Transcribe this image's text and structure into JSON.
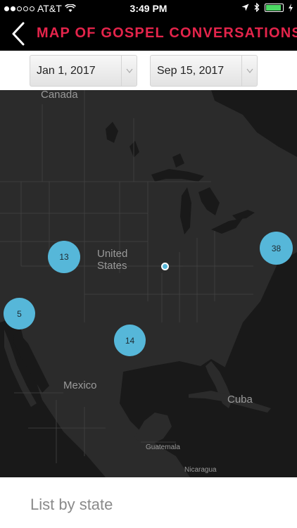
{
  "status_bar": {
    "carrier": "AT&T",
    "time": "3:49 PM",
    "signal_bars": 2,
    "battery_level": 0.9,
    "icons": [
      "signal-icon",
      "wifi-icon",
      "location-arrow-icon",
      "bluetooth-icon",
      "battery-icon",
      "charging-icon"
    ]
  },
  "header": {
    "title": "MAP OF GOSPEL CONVERSATIONS",
    "back_icon": "back-chevron-icon",
    "title_color": "#e4244b"
  },
  "filters": {
    "start_date": "Jan 1, 2017",
    "end_date": "Sep 15, 2017"
  },
  "map": {
    "labels": {
      "canada": "Canada",
      "united_states": "United\nStates",
      "mexico": "Mexico",
      "cuba": "Cuba",
      "guatemala": "Guatemala",
      "nicaragua": "Nicaragua"
    },
    "clusters": [
      {
        "id": "west",
        "count": "13"
      },
      {
        "id": "southwest",
        "count": "5"
      },
      {
        "id": "texas",
        "count": "14"
      },
      {
        "id": "northeast",
        "count": "38"
      }
    ],
    "marker_color": "#56b7d9",
    "land_color": "#2b2b2b",
    "water_color": "#191919"
  },
  "list": {
    "heading": "List by state"
  }
}
